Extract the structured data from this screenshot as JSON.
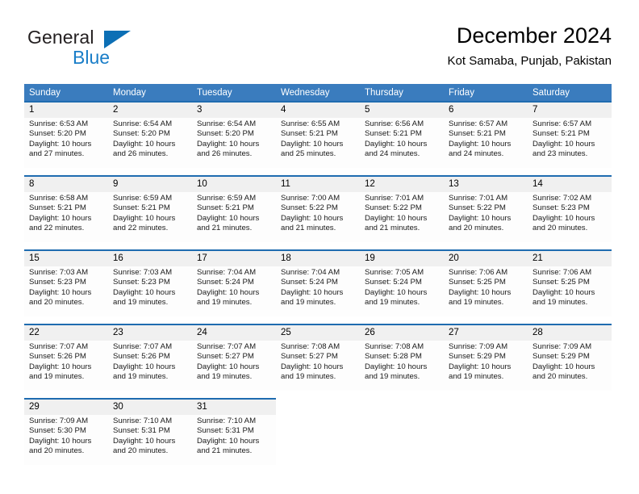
{
  "brand": {
    "name_top": "General",
    "name_bottom": "Blue",
    "color_dark": "#231f20",
    "color_blue": "#1a7ec8"
  },
  "header": {
    "title": "December 2024",
    "subtitle": "Kot Samaba, Punjab, Pakistan"
  },
  "theme": {
    "header_bg": "#3a7cbe",
    "daynum_bg": "#f0f0f0",
    "rule_color": "#1f6cb0"
  },
  "weekday_headers": [
    "Sunday",
    "Monday",
    "Tuesday",
    "Wednesday",
    "Thursday",
    "Friday",
    "Saturday"
  ],
  "weeks": [
    {
      "days": [
        {
          "num": "1",
          "sunrise": "Sunrise: 6:53 AM",
          "sunset": "Sunset: 5:20 PM",
          "daylight1": "Daylight: 10 hours",
          "daylight2": "and 27 minutes."
        },
        {
          "num": "2",
          "sunrise": "Sunrise: 6:54 AM",
          "sunset": "Sunset: 5:20 PM",
          "daylight1": "Daylight: 10 hours",
          "daylight2": "and 26 minutes."
        },
        {
          "num": "3",
          "sunrise": "Sunrise: 6:54 AM",
          "sunset": "Sunset: 5:20 PM",
          "daylight1": "Daylight: 10 hours",
          "daylight2": "and 26 minutes."
        },
        {
          "num": "4",
          "sunrise": "Sunrise: 6:55 AM",
          "sunset": "Sunset: 5:21 PM",
          "daylight1": "Daylight: 10 hours",
          "daylight2": "and 25 minutes."
        },
        {
          "num": "5",
          "sunrise": "Sunrise: 6:56 AM",
          "sunset": "Sunset: 5:21 PM",
          "daylight1": "Daylight: 10 hours",
          "daylight2": "and 24 minutes."
        },
        {
          "num": "6",
          "sunrise": "Sunrise: 6:57 AM",
          "sunset": "Sunset: 5:21 PM",
          "daylight1": "Daylight: 10 hours",
          "daylight2": "and 24 minutes."
        },
        {
          "num": "7",
          "sunrise": "Sunrise: 6:57 AM",
          "sunset": "Sunset: 5:21 PM",
          "daylight1": "Daylight: 10 hours",
          "daylight2": "and 23 minutes."
        }
      ]
    },
    {
      "days": [
        {
          "num": "8",
          "sunrise": "Sunrise: 6:58 AM",
          "sunset": "Sunset: 5:21 PM",
          "daylight1": "Daylight: 10 hours",
          "daylight2": "and 22 minutes."
        },
        {
          "num": "9",
          "sunrise": "Sunrise: 6:59 AM",
          "sunset": "Sunset: 5:21 PM",
          "daylight1": "Daylight: 10 hours",
          "daylight2": "and 22 minutes."
        },
        {
          "num": "10",
          "sunrise": "Sunrise: 6:59 AM",
          "sunset": "Sunset: 5:21 PM",
          "daylight1": "Daylight: 10 hours",
          "daylight2": "and 21 minutes."
        },
        {
          "num": "11",
          "sunrise": "Sunrise: 7:00 AM",
          "sunset": "Sunset: 5:22 PM",
          "daylight1": "Daylight: 10 hours",
          "daylight2": "and 21 minutes."
        },
        {
          "num": "12",
          "sunrise": "Sunrise: 7:01 AM",
          "sunset": "Sunset: 5:22 PM",
          "daylight1": "Daylight: 10 hours",
          "daylight2": "and 21 minutes."
        },
        {
          "num": "13",
          "sunrise": "Sunrise: 7:01 AM",
          "sunset": "Sunset: 5:22 PM",
          "daylight1": "Daylight: 10 hours",
          "daylight2": "and 20 minutes."
        },
        {
          "num": "14",
          "sunrise": "Sunrise: 7:02 AM",
          "sunset": "Sunset: 5:23 PM",
          "daylight1": "Daylight: 10 hours",
          "daylight2": "and 20 minutes."
        }
      ]
    },
    {
      "days": [
        {
          "num": "15",
          "sunrise": "Sunrise: 7:03 AM",
          "sunset": "Sunset: 5:23 PM",
          "daylight1": "Daylight: 10 hours",
          "daylight2": "and 20 minutes."
        },
        {
          "num": "16",
          "sunrise": "Sunrise: 7:03 AM",
          "sunset": "Sunset: 5:23 PM",
          "daylight1": "Daylight: 10 hours",
          "daylight2": "and 19 minutes."
        },
        {
          "num": "17",
          "sunrise": "Sunrise: 7:04 AM",
          "sunset": "Sunset: 5:24 PM",
          "daylight1": "Daylight: 10 hours",
          "daylight2": "and 19 minutes."
        },
        {
          "num": "18",
          "sunrise": "Sunrise: 7:04 AM",
          "sunset": "Sunset: 5:24 PM",
          "daylight1": "Daylight: 10 hours",
          "daylight2": "and 19 minutes."
        },
        {
          "num": "19",
          "sunrise": "Sunrise: 7:05 AM",
          "sunset": "Sunset: 5:24 PM",
          "daylight1": "Daylight: 10 hours",
          "daylight2": "and 19 minutes."
        },
        {
          "num": "20",
          "sunrise": "Sunrise: 7:06 AM",
          "sunset": "Sunset: 5:25 PM",
          "daylight1": "Daylight: 10 hours",
          "daylight2": "and 19 minutes."
        },
        {
          "num": "21",
          "sunrise": "Sunrise: 7:06 AM",
          "sunset": "Sunset: 5:25 PM",
          "daylight1": "Daylight: 10 hours",
          "daylight2": "and 19 minutes."
        }
      ]
    },
    {
      "days": [
        {
          "num": "22",
          "sunrise": "Sunrise: 7:07 AM",
          "sunset": "Sunset: 5:26 PM",
          "daylight1": "Daylight: 10 hours",
          "daylight2": "and 19 minutes."
        },
        {
          "num": "23",
          "sunrise": "Sunrise: 7:07 AM",
          "sunset": "Sunset: 5:26 PM",
          "daylight1": "Daylight: 10 hours",
          "daylight2": "and 19 minutes."
        },
        {
          "num": "24",
          "sunrise": "Sunrise: 7:07 AM",
          "sunset": "Sunset: 5:27 PM",
          "daylight1": "Daylight: 10 hours",
          "daylight2": "and 19 minutes."
        },
        {
          "num": "25",
          "sunrise": "Sunrise: 7:08 AM",
          "sunset": "Sunset: 5:27 PM",
          "daylight1": "Daylight: 10 hours",
          "daylight2": "and 19 minutes."
        },
        {
          "num": "26",
          "sunrise": "Sunrise: 7:08 AM",
          "sunset": "Sunset: 5:28 PM",
          "daylight1": "Daylight: 10 hours",
          "daylight2": "and 19 minutes."
        },
        {
          "num": "27",
          "sunrise": "Sunrise: 7:09 AM",
          "sunset": "Sunset: 5:29 PM",
          "daylight1": "Daylight: 10 hours",
          "daylight2": "and 19 minutes."
        },
        {
          "num": "28",
          "sunrise": "Sunrise: 7:09 AM",
          "sunset": "Sunset: 5:29 PM",
          "daylight1": "Daylight: 10 hours",
          "daylight2": "and 20 minutes."
        }
      ]
    },
    {
      "days": [
        {
          "num": "29",
          "sunrise": "Sunrise: 7:09 AM",
          "sunset": "Sunset: 5:30 PM",
          "daylight1": "Daylight: 10 hours",
          "daylight2": "and 20 minutes."
        },
        {
          "num": "30",
          "sunrise": "Sunrise: 7:10 AM",
          "sunset": "Sunset: 5:31 PM",
          "daylight1": "Daylight: 10 hours",
          "daylight2": "and 20 minutes."
        },
        {
          "num": "31",
          "sunrise": "Sunrise: 7:10 AM",
          "sunset": "Sunset: 5:31 PM",
          "daylight1": "Daylight: 10 hours",
          "daylight2": "and 21 minutes."
        },
        {
          "num": "",
          "sunrise": "",
          "sunset": "",
          "daylight1": "",
          "daylight2": "",
          "empty": true
        },
        {
          "num": "",
          "sunrise": "",
          "sunset": "",
          "daylight1": "",
          "daylight2": "",
          "empty": true
        },
        {
          "num": "",
          "sunrise": "",
          "sunset": "",
          "daylight1": "",
          "daylight2": "",
          "empty": true
        },
        {
          "num": "",
          "sunrise": "",
          "sunset": "",
          "daylight1": "",
          "daylight2": "",
          "empty": true
        }
      ]
    }
  ]
}
